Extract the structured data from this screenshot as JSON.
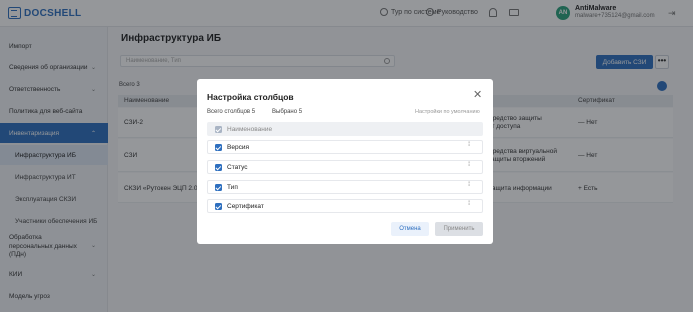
{
  "app": {
    "logo": "DOCSHELL"
  },
  "topbar": {
    "tour": "Тур по системе",
    "guide": "Руководство",
    "avatar_initials": "AN",
    "user_name": "AntiMalware",
    "user_email": "malware+735124@gmail.com"
  },
  "sidebar": {
    "items": [
      {
        "label": "Импорт"
      },
      {
        "label": "Сведения об организации"
      },
      {
        "label": "Ответственность"
      },
      {
        "label": "Политика для веб-сайта"
      },
      {
        "label": "Инвентаризация"
      },
      {
        "label": "Инфраструктура ИБ"
      },
      {
        "label": "Инфраструктура ИТ"
      },
      {
        "label": "Эксплуатация СКЗИ"
      },
      {
        "label": "Участники обеспечения ИБ"
      },
      {
        "label": "Обработка персональных данных (ПДн)"
      },
      {
        "label": "КИИ"
      },
      {
        "label": "Модель угроз"
      }
    ]
  },
  "main": {
    "title": "Инфраструктура ИБ",
    "search_placeholder": "Наименование, Тип",
    "add_button": "Добавить СЗИ",
    "more_button": "•••",
    "total": "Всего 3",
    "columns": {
      "name": "Наименование",
      "cert": "Сертификат"
    },
    "rows": [
      {
        "name": "СЗИ-2",
        "type": "Средство защиты\nот доступа",
        "cert": "—  Нет"
      },
      {
        "name": "СЗИ",
        "type": "Средства виртуальной\nзащиты вторжений",
        "cert": "—  Нет"
      },
      {
        "name": "СКЗИ «Рутокен ЭЦП 2.0»",
        "type": "Защита информации",
        "cert": "+  Есть"
      }
    ]
  },
  "modal": {
    "title": "Настройка столбцов",
    "total_columns": "Всего столбцов 5",
    "selected": "Выбрано 5",
    "default_link": "Настройки по умолчанию",
    "columns": [
      {
        "label": "Наименование"
      },
      {
        "label": "Версия"
      },
      {
        "label": "Статус"
      },
      {
        "label": "Тип"
      },
      {
        "label": "Сертификат"
      }
    ],
    "cancel": "Отмена",
    "apply": "Применить"
  },
  "colors": {
    "accent": "#2e6fbf",
    "overlay": "rgba(20,24,30,0.45)"
  }
}
